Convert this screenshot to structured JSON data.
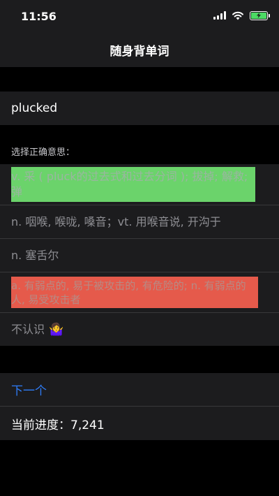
{
  "status_bar": {
    "time": "11:56"
  },
  "nav": {
    "title": "随身背单词"
  },
  "word": {
    "text": "plucked"
  },
  "prompt": {
    "label": "选择正确意思："
  },
  "options": [
    {
      "text": "v. 采 ( pluck的过去式和过去分词 ); 拔掉; 解救; 弹",
      "state": "correct",
      "highlight_color": "#6bd36b"
    },
    {
      "text": "n. 咽喉, 喉咙, 嗓音；vt. 用喉音说, 开沟于",
      "state": "default"
    },
    {
      "text": "n. 塞舌尔",
      "state": "default"
    },
    {
      "text": "a. 有弱点的, 易于被攻击的, 有危险的; n. 有弱点的人, 易受攻击者",
      "state": "wrong",
      "highlight_color": "#e55a4b"
    },
    {
      "text": "不认识",
      "state": "default",
      "icon": "person-shrugging-emoji"
    }
  ],
  "actions": {
    "next_label": "下一个"
  },
  "progress": {
    "text": "当前进度：7,241"
  },
  "colors": {
    "background": "#000000",
    "cell": "#1c1c1e",
    "separator": "#38383a",
    "link": "#2f7cf6",
    "battery": "#4cd964"
  }
}
